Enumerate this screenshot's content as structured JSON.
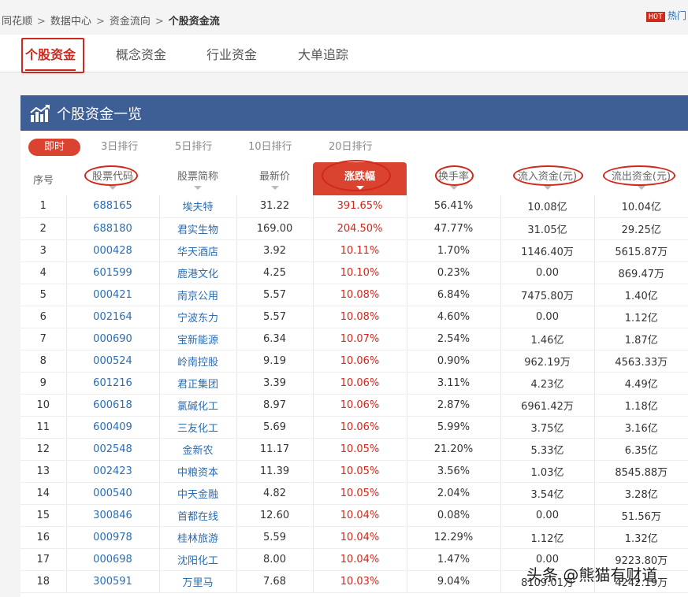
{
  "breadcrumb": [
    "同花顺",
    "数据中心",
    "资金流向",
    "个股资金流"
  ],
  "hot": {
    "badge": "HOT",
    "text": "热门"
  },
  "tabs": [
    "个股资金",
    "概念资金",
    "行业资金",
    "大单追踪"
  ],
  "panel": {
    "title": "个股资金一览",
    "icon": "chart-trend-icon"
  },
  "subtabs": [
    "即时",
    "3日排行",
    "5日排行",
    "10日排行",
    "20日排行"
  ],
  "columns": [
    "序号",
    "股票代码",
    "股票简称",
    "最新价",
    "涨跌幅",
    "换手率",
    "流入资金(元)",
    "流出资金(元)"
  ],
  "rows": [
    [
      "1",
      "688165",
      "埃夫特",
      "31.22",
      "391.65%",
      "56.41%",
      "10.08亿",
      "10.04亿"
    ],
    [
      "2",
      "688180",
      "君实生物",
      "169.00",
      "204.50%",
      "47.77%",
      "31.05亿",
      "29.25亿"
    ],
    [
      "3",
      "000428",
      "华天酒店",
      "3.92",
      "10.11%",
      "1.70%",
      "1146.40万",
      "5615.87万"
    ],
    [
      "4",
      "601599",
      "鹿港文化",
      "4.25",
      "10.10%",
      "0.23%",
      "0.00",
      "869.47万"
    ],
    [
      "5",
      "000421",
      "南京公用",
      "5.57",
      "10.08%",
      "6.84%",
      "7475.80万",
      "1.40亿"
    ],
    [
      "6",
      "002164",
      "宁波东力",
      "5.57",
      "10.08%",
      "4.60%",
      "0.00",
      "1.12亿"
    ],
    [
      "7",
      "000690",
      "宝新能源",
      "6.34",
      "10.07%",
      "2.54%",
      "1.46亿",
      "1.87亿"
    ],
    [
      "8",
      "000524",
      "岭南控股",
      "9.19",
      "10.06%",
      "0.90%",
      "962.19万",
      "4563.33万"
    ],
    [
      "9",
      "601216",
      "君正集团",
      "3.39",
      "10.06%",
      "3.11%",
      "4.23亿",
      "4.49亿"
    ],
    [
      "10",
      "600618",
      "氯碱化工",
      "8.97",
      "10.06%",
      "2.87%",
      "6961.42万",
      "1.18亿"
    ],
    [
      "11",
      "600409",
      "三友化工",
      "5.69",
      "10.06%",
      "5.99%",
      "3.75亿",
      "3.16亿"
    ],
    [
      "12",
      "002548",
      "金新农",
      "11.17",
      "10.05%",
      "21.20%",
      "5.33亿",
      "6.35亿"
    ],
    [
      "13",
      "002423",
      "中粮资本",
      "11.39",
      "10.05%",
      "3.56%",
      "1.03亿",
      "8545.88万"
    ],
    [
      "14",
      "000540",
      "中天金融",
      "4.82",
      "10.05%",
      "2.04%",
      "3.54亿",
      "3.28亿"
    ],
    [
      "15",
      "300846",
      "首都在线",
      "12.60",
      "10.04%",
      "0.08%",
      "0.00",
      "51.56万"
    ],
    [
      "16",
      "000978",
      "桂林旅游",
      "5.59",
      "10.04%",
      "12.29%",
      "1.12亿",
      "1.32亿"
    ],
    [
      "17",
      "000698",
      "沈阳化工",
      "8.00",
      "10.04%",
      "1.47%",
      "0.00",
      "9223.80万"
    ],
    [
      "18",
      "300591",
      "万里马",
      "7.68",
      "10.03%",
      "9.04%",
      "8109.01万",
      "4242.19万"
    ]
  ],
  "watermark": "头条 @熊猫有财道",
  "colors": {
    "accent": "#d0281c",
    "header_bg": "#3d5f96",
    "link": "#2b6db3"
  }
}
